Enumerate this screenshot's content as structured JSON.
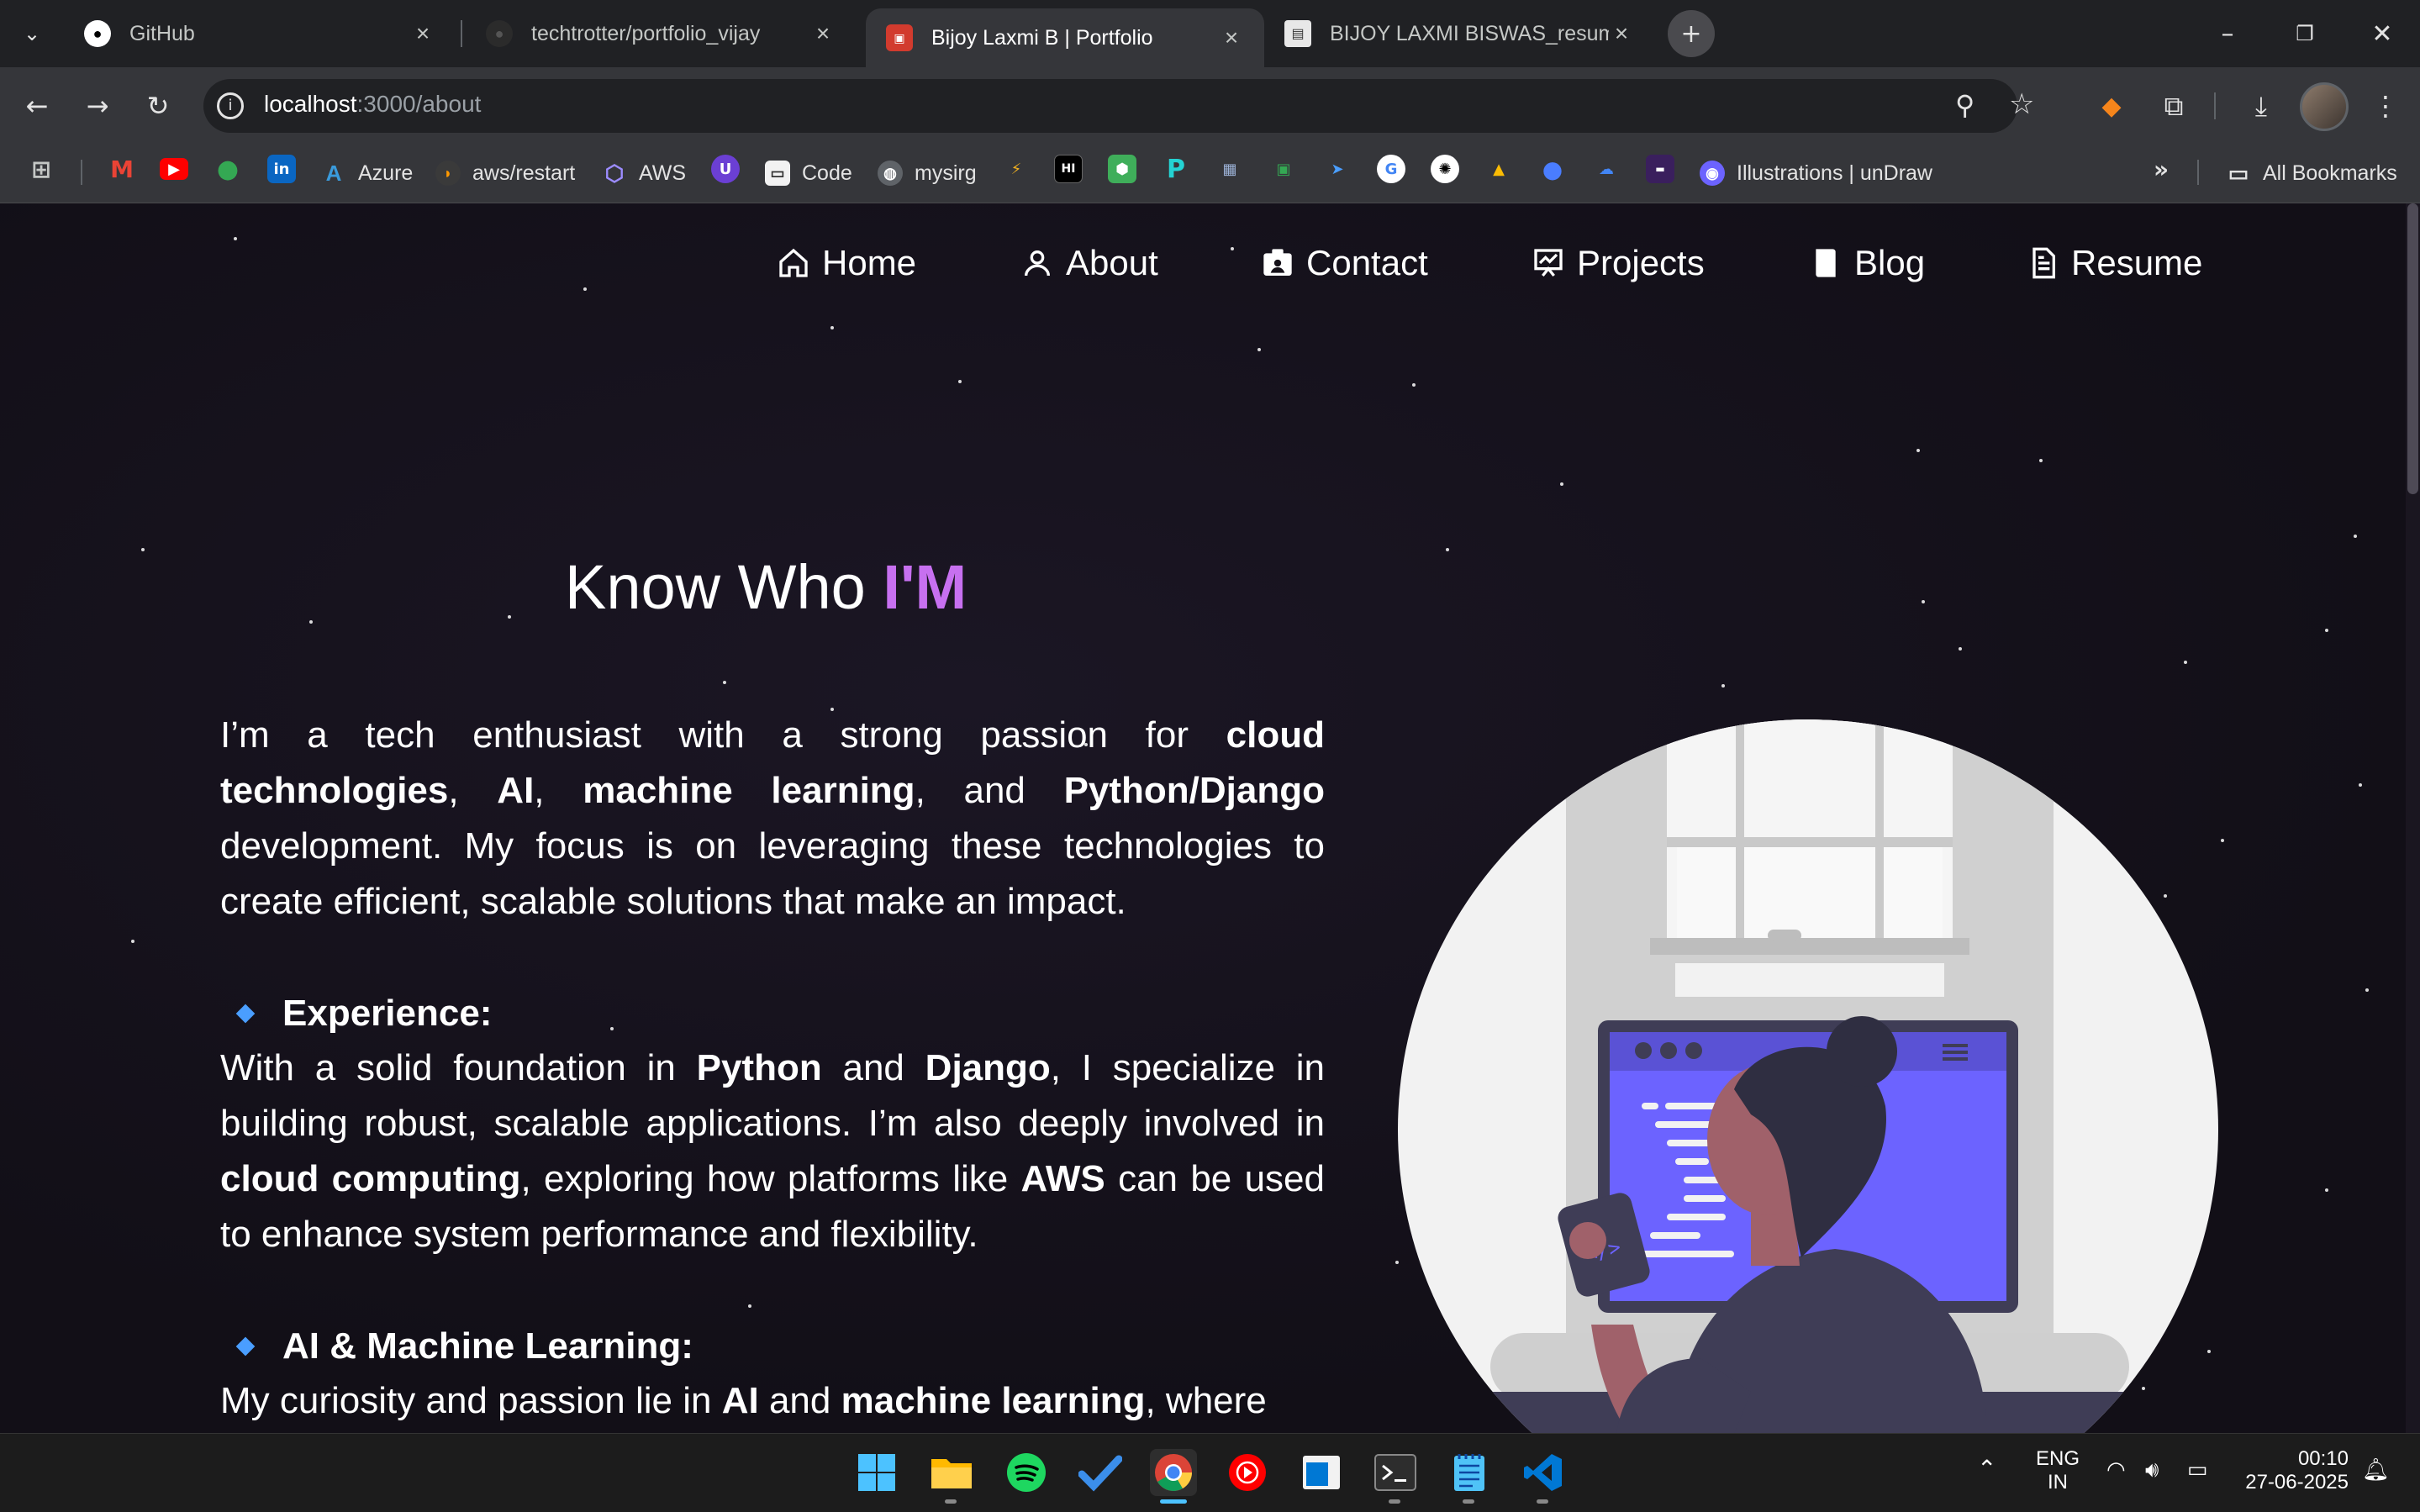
{
  "browser": {
    "tabs": [
      {
        "title": "GitHub",
        "icon": "github-icon"
      },
      {
        "title": "techtrotter/portfolio_vijay",
        "icon": "github-icon"
      },
      {
        "title": "Bijoy Laxmi B | Portfolio",
        "icon": "portfolio-favicon"
      },
      {
        "title": "BIJOY LAXMI BISWAS_resume.d",
        "icon": "document-icon"
      }
    ],
    "url": {
      "host": "localhost",
      "rest": ":3000/about"
    },
    "bookmarks": [
      {
        "label": "Azure"
      },
      {
        "label": "aws/restart"
      },
      {
        "label": "AWS"
      },
      {
        "label": "Code"
      },
      {
        "label": "mysirg"
      },
      {
        "label": "Illustrations | unDraw"
      }
    ],
    "all_bookmarks": "All Bookmarks"
  },
  "nav": {
    "home": "Home",
    "about": "About",
    "contact": "Contact",
    "projects": "Projects",
    "blog": "Blog",
    "resume": "Resume"
  },
  "about": {
    "heading_prefix": "Know Who ",
    "heading_accent": "I'M",
    "intro": {
      "t1": "I’m a tech enthusiast with a strong passion for ",
      "b1": "cloud technologies",
      "t2": ", ",
      "b2": "AI",
      "t3": ", ",
      "b3": "machine learning",
      "t4": ", and ",
      "b4": "Python/Django",
      "t5": " development. My focus is on leveraging these technologies to create efficient, scalable solutions that make an impact."
    },
    "experience": {
      "title": "Experience:",
      "t1": "With a solid foundation in ",
      "b1": "Python",
      "t2": " and ",
      "b2": "Django",
      "t3": ", I specialize in building robust, scalable applications. I’m also deeply involved in ",
      "b3": "cloud computing",
      "t4": ", exploring how platforms like ",
      "b4": "AWS",
      "t5": " can be used to enhance system performance and flexibility."
    },
    "ai_ml": {
      "title": "AI & Machine Learning:",
      "t1": "My curiosity and passion lie in ",
      "b1": "AI",
      "t2": " and ",
      "b2": "machine learning",
      "t3": ", where"
    }
  },
  "taskbar": {
    "lang_1": "ENG",
    "lang_2": "IN",
    "time": "00:10",
    "date": "27-06-2025"
  },
  "colors": {
    "accent": "#c770f0",
    "bullet": "#4a9eff",
    "illustration_purple": "#6c63ff"
  }
}
